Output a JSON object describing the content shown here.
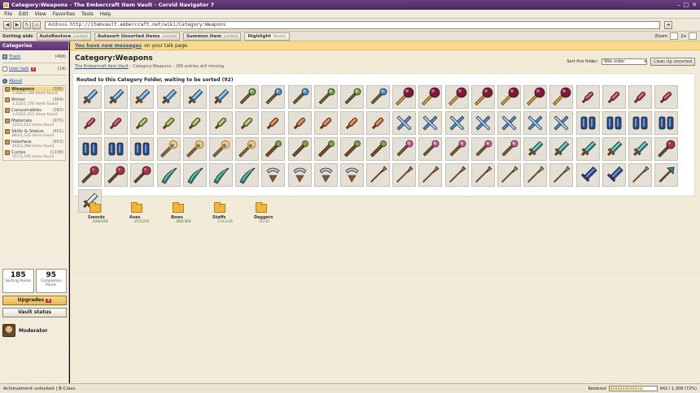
{
  "window": {
    "title": "Category:Weapons - The Embercraft Item Vault - Corvid Navigator 7"
  },
  "menu": [
    "File",
    "Edit",
    "View",
    "Favorites",
    "Tools",
    "Help"
  ],
  "address": {
    "label": "Address",
    "url": "http://itemvault.embercraft.net/wiki/Category:Weapons"
  },
  "toolbar": {
    "label": "Sorting aids",
    "buttons": [
      {
        "label": "AutoRestore",
        "state": "Locked"
      },
      {
        "label": "Autosort Unsorted Items",
        "state": "Locked"
      },
      {
        "label": "Summon Item",
        "state": "Locked"
      },
      {
        "label": "Highlight",
        "state": "Ready"
      }
    ],
    "zoom_label": "Zoom",
    "zoom_value": "2x"
  },
  "sidebar": {
    "heading": "Categories",
    "trash": {
      "label": "Trash",
      "count": "(468)"
    },
    "talk": {
      "label": "User talk",
      "badge": "4",
      "count": "(14)"
    },
    "about": "About",
    "categories": [
      {
        "name": "Weapons",
        "count": "(366)",
        "found": "1,006/1,358 items found",
        "selected": true
      },
      {
        "name": "Armor",
        "count": "(364)",
        "found": "1,122/1,176 items found"
      },
      {
        "name": "Consumables",
        "count": "(382)",
        "found": "1,030/1,412 items found"
      },
      {
        "name": "Materials",
        "count": "(975)",
        "found": "537/1,512 items found"
      },
      {
        "name": "Skills & Status",
        "count": "(651)",
        "found": "881/1,532 items found"
      },
      {
        "name": "Interface",
        "count": "(953)",
        "found": "415/1,368 items found"
      },
      {
        "name": "Curios",
        "count": "(1108)",
        "found": "557/1,596 items found"
      }
    ],
    "points": [
      {
        "value": "185",
        "label": "Sorting Points"
      },
      {
        "value": "95",
        "label": "Completion Points"
      }
    ],
    "upgrades_label": "Upgrades",
    "upgrades_badge": "3",
    "vault_label": "Vault status",
    "user": "Moderator"
  },
  "main": {
    "message": {
      "link": "You have new messages",
      "rest": "on your talk page."
    },
    "title": "Category:Weapons",
    "breadcrumb": {
      "root": "The Embercraft Item Vault",
      "rest": "› Category:Weapons › 266 entries still missing"
    },
    "sort": {
      "label": "Sort this folder:",
      "value": "Wiki order",
      "clean_label": "Clean Up Unsorted"
    },
    "panel_heading": "Routed to this Category Folder, waiting to be sorted (92)",
    "folders": [
      {
        "name": "Swords",
        "count": "426/426"
      },
      {
        "name": "Axes",
        "count": "252/252"
      },
      {
        "name": "Bows",
        "count": "364/364"
      },
      {
        "name": "Staffs",
        "count": "124/228"
      },
      {
        "name": "Daggers",
        "count": "0/240"
      }
    ]
  },
  "items": [
    "sword-blue",
    "sword-blue",
    "sword-blue",
    "sword-blue",
    "sword-blue",
    "sword-blue",
    "wand-green",
    "wand-blue",
    "wand-blue",
    "wand-green",
    "wand-green",
    "wand-blue",
    "orb-staff-gold",
    "orb-staff-gold",
    "orb-staff-gold",
    "orb-staff-gold",
    "orb-staff-gold",
    "orb-staff-gold",
    "orb-staff-gold",
    "dagger-red",
    "dagger-red",
    "dagger-red",
    "dagger-red",
    "dagger-red",
    "dagger-red",
    "dagger-green",
    "dagger-green",
    "dagger-green",
    "dagger-green",
    "dagger-green",
    "dagger-orange",
    "dagger-orange",
    "dagger-orange",
    "dagger-orange",
    "dagger-orange",
    "crossed-blue",
    "crossed-blue",
    "crossed-blue",
    "crossed-blue",
    "crossed-blue",
    "crossed-blue",
    "crossed-blue",
    "twin-blades-navy",
    "twin-blades-navy",
    "twin-blades-navy",
    "twin-blades-navy",
    "twin-blades-navy",
    "twin-blades-navy",
    "twin-blades-navy",
    "scepter-gold",
    "scepter-gold",
    "scepter-gold",
    "scepter-gold",
    "staff-green",
    "staff-green",
    "staff-green",
    "staff-green",
    "staff-green",
    "wand-pink",
    "wand-pink",
    "wand-pink",
    "wand-pink",
    "wand-pink",
    "trident-teal",
    "trident-teal",
    "trident-teal",
    "trident-teal",
    "trident-teal",
    "mace-red",
    "mace-red",
    "mace-red",
    "mace-red",
    "scimitar-teal",
    "scimitar-teal",
    "scimitar-teal",
    "scimitar-teal",
    "bow-white",
    "bow-white",
    "bow-white",
    "bow-white",
    "spear-orange",
    "spear-orange",
    "spear-orange",
    "spear-orange",
    "spear-orange",
    "spear-green",
    "spear-green",
    "spear-green",
    "greatsword-navy",
    "greatsword-navy",
    "spear-thin",
    "axe-teal",
    "sword-white"
  ],
  "status": {
    "text": "Achievement unlocked | B-Class.",
    "restored_label": "Restored",
    "restored_progress": 0.72,
    "restored_text": "942 / 1,308 (72%)"
  }
}
